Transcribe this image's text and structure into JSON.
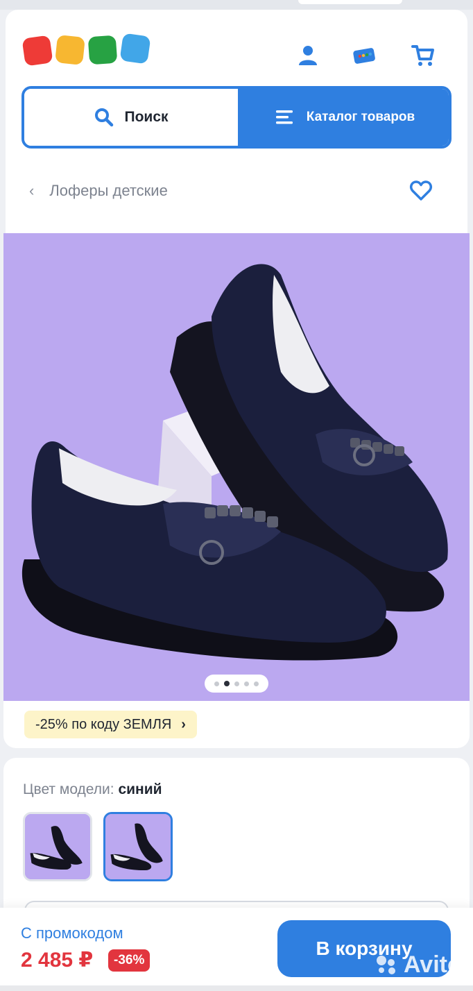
{
  "header": {
    "search_label": "Поиск",
    "catalog_label": "Каталог товаров",
    "logo_colors": [
      "#ee3b37",
      "#f7b731",
      "#27a243",
      "#41a6e8"
    ],
    "accent_color": "#2f7fe0"
  },
  "breadcrumb": {
    "back_icon": "chevron-left-icon",
    "title": "Лоферы детские"
  },
  "gallery": {
    "background_color": "#bba8f0",
    "slide_count": 5,
    "active_slide": 2
  },
  "promo": {
    "text": "-25% по коду ЗЕМЛЯ",
    "arrow": "›"
  },
  "color_select": {
    "label": "Цвет модели:",
    "value": "синий",
    "options_count": 2,
    "selected_index": 1
  },
  "bottom_bar": {
    "promo_price_label": "С промокодом",
    "price": "2 485 ₽",
    "discount": "-36%",
    "cart_button_label": "В корзину",
    "price_color": "#e2353e"
  },
  "watermark": {
    "text": "Avito"
  }
}
